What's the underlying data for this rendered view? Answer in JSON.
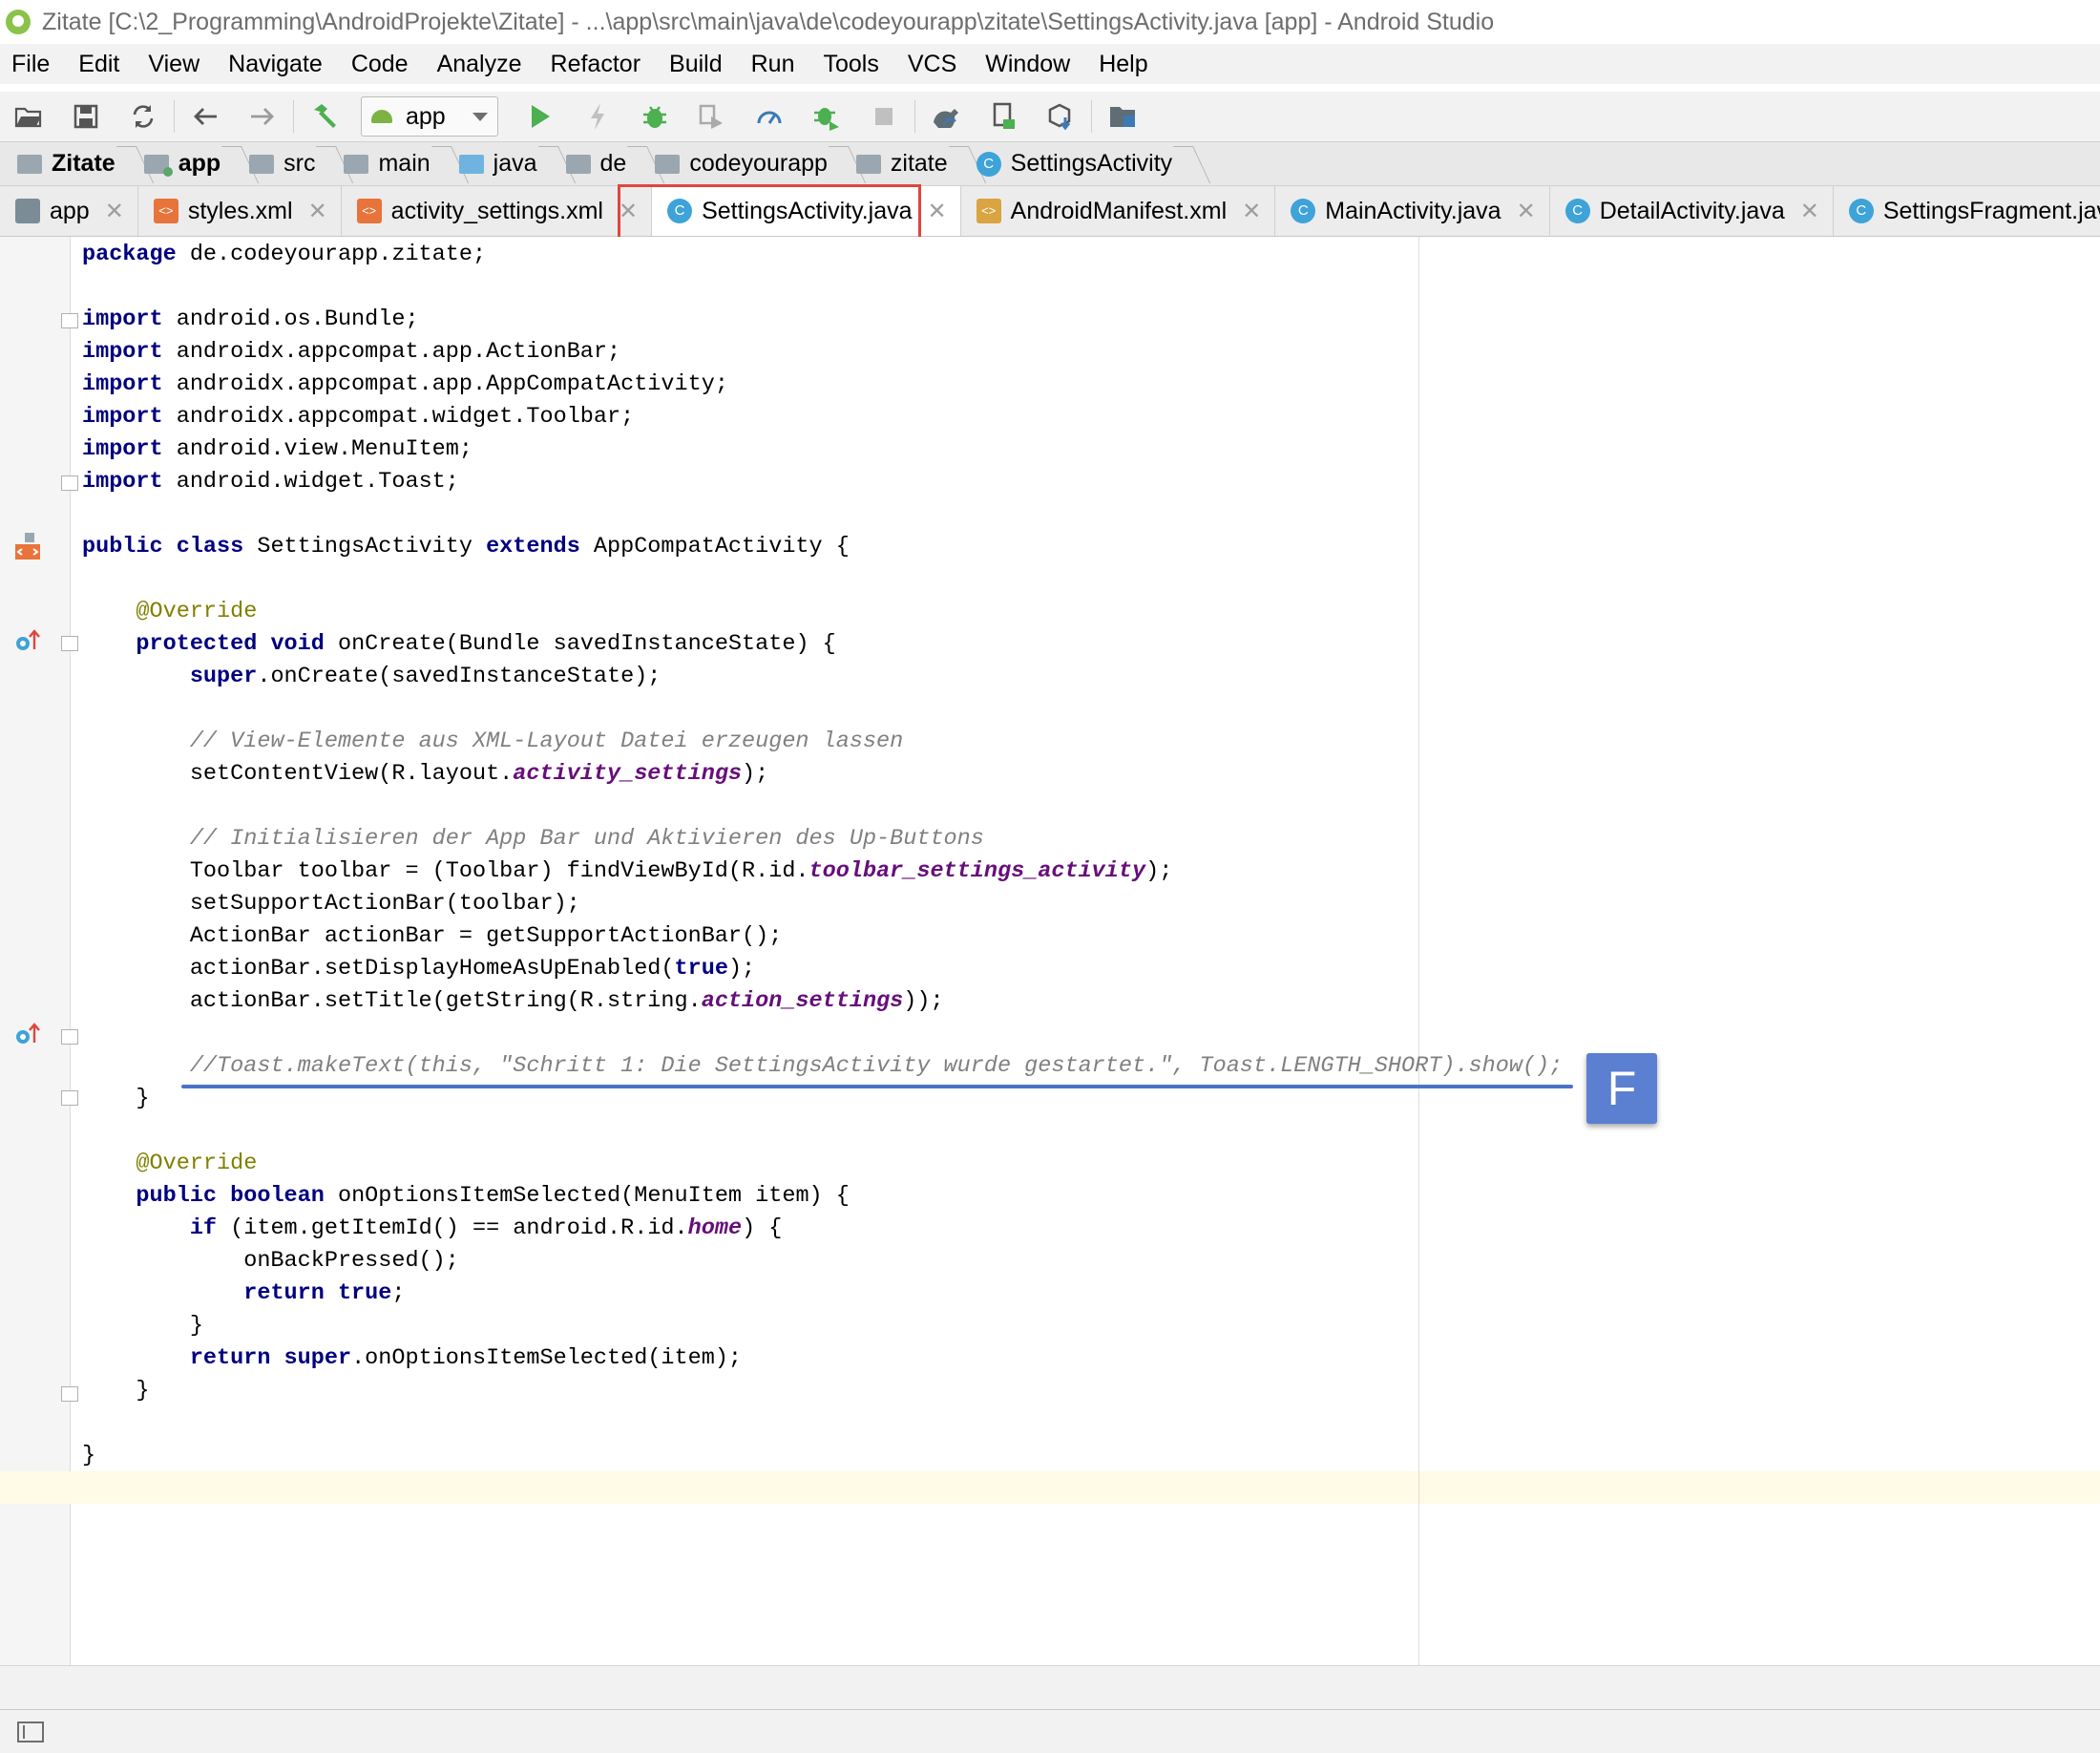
{
  "window": {
    "title": "Zitate [C:\\2_Programming\\AndroidProjekte\\Zitate] - ...\\app\\src\\main\\java\\de\\codeyourapp\\zitate\\SettingsActivity.java [app] - Android Studio"
  },
  "menu": [
    "File",
    "Edit",
    "View",
    "Navigate",
    "Code",
    "Analyze",
    "Refactor",
    "Build",
    "Run",
    "Tools",
    "VCS",
    "Window",
    "Help"
  ],
  "toolbar": {
    "run_config": "app",
    "icons": [
      "open-icon",
      "save-icon",
      "sync-icon",
      "back-icon",
      "forward-icon",
      "make-project-icon",
      "run-icon",
      "apply-changes-icon",
      "debug-icon",
      "profile-icon",
      "attach-debugger-icon",
      "stop-icon",
      "gradle-sync-icon",
      "avd-manager-icon",
      "sdk-manager-icon",
      "project-structure-icon"
    ]
  },
  "breadcrumb": [
    "Zitate",
    "app",
    "src",
    "main",
    "java",
    "de",
    "codeyourapp",
    "zitate",
    "SettingsActivity"
  ],
  "tabs": [
    {
      "label": "app",
      "active": false,
      "icon": "gradle"
    },
    {
      "label": "styles.xml",
      "active": false,
      "icon": "xml"
    },
    {
      "label": "activity_settings.xml",
      "active": false,
      "icon": "xml"
    },
    {
      "label": "SettingsActivity.java",
      "active": true,
      "icon": "class"
    },
    {
      "label": "AndroidManifest.xml",
      "active": false,
      "icon": "manifest"
    },
    {
      "label": "MainActivity.java",
      "active": false,
      "icon": "class"
    },
    {
      "label": "DetailActivity.java",
      "active": false,
      "icon": "class"
    },
    {
      "label": "SettingsFragment.java",
      "active": false,
      "icon": "class"
    }
  ],
  "editor": {
    "lines": [
      [
        [
          "kw",
          "package"
        ],
        [
          "t",
          " de.codeyourapp.zitate;"
        ]
      ],
      [],
      [
        [
          "kw",
          "import"
        ],
        [
          "t",
          " android.os.Bundle;"
        ]
      ],
      [
        [
          "kw",
          "import"
        ],
        [
          "t",
          " androidx.appcompat.app.ActionBar;"
        ]
      ],
      [
        [
          "kw",
          "import"
        ],
        [
          "t",
          " androidx.appcompat.app.AppCompatActivity;"
        ]
      ],
      [
        [
          "kw",
          "import"
        ],
        [
          "t",
          " androidx.appcompat.widget.Toolbar;"
        ]
      ],
      [
        [
          "kw",
          "import"
        ],
        [
          "t",
          " android.view.MenuItem;"
        ]
      ],
      [
        [
          "kw",
          "import"
        ],
        [
          "t",
          " android.widget.Toast;"
        ]
      ],
      [],
      [
        [
          "kw",
          "public class"
        ],
        [
          "t",
          " SettingsActivity "
        ],
        [
          "kw",
          "extends"
        ],
        [
          "t",
          " AppCompatActivity {"
        ]
      ],
      [],
      [
        [
          "t",
          "    "
        ],
        [
          "an",
          "@Override"
        ]
      ],
      [
        [
          "t",
          "    "
        ],
        [
          "kw",
          "protected void"
        ],
        [
          "t",
          " onCreate(Bundle savedInstanceState) {"
        ]
      ],
      [
        [
          "t",
          "        "
        ],
        [
          "kw",
          "super"
        ],
        [
          "t",
          ".onCreate(savedInstanceState);"
        ]
      ],
      [],
      [
        [
          "t",
          "        "
        ],
        [
          "cm",
          "// View-Elemente aus XML-Layout Datei erzeugen lassen"
        ]
      ],
      [
        [
          "t",
          "        setContentView(R.layout."
        ],
        [
          "fd",
          "activity_settings"
        ],
        [
          "t",
          ");"
        ]
      ],
      [],
      [
        [
          "t",
          "        "
        ],
        [
          "cm",
          "// Initialisieren der App Bar und Aktivieren des Up-Buttons"
        ]
      ],
      [
        [
          "t",
          "        Toolbar toolbar = (Toolbar) findViewById(R.id."
        ],
        [
          "fd",
          "toolbar_settings_activity"
        ],
        [
          "t",
          ");"
        ]
      ],
      [
        [
          "t",
          "        setSupportActionBar(toolbar);"
        ]
      ],
      [
        [
          "t",
          "        ActionBar actionBar = getSupportActionBar();"
        ]
      ],
      [
        [
          "t",
          "        actionBar.setDisplayHomeAsUpEnabled("
        ],
        [
          "kw",
          "true"
        ],
        [
          "t",
          ");"
        ]
      ],
      [
        [
          "t",
          "        actionBar.setTitle(getString(R.string."
        ],
        [
          "fd",
          "action_settings"
        ],
        [
          "t",
          "));"
        ]
      ],
      [],
      [
        [
          "t",
          "        "
        ],
        [
          "cm",
          "//Toast.makeText(this, \"Schritt 1: Die SettingsActivity wurde gestartet.\", Toast.LENGTH_SHORT).show();"
        ]
      ],
      [
        [
          "t",
          "    }"
        ]
      ],
      [],
      [
        [
          "t",
          "    "
        ],
        [
          "an",
          "@Override"
        ]
      ],
      [
        [
          "t",
          "    "
        ],
        [
          "kw",
          "public boolean"
        ],
        [
          "t",
          " onOptionsItemSelected(MenuItem item) {"
        ]
      ],
      [
        [
          "t",
          "        "
        ],
        [
          "kw",
          "if"
        ],
        [
          "t",
          " (item.getItemId() == android.R.id."
        ],
        [
          "fd",
          "home"
        ],
        [
          "t",
          ") {"
        ]
      ],
      [
        [
          "t",
          "            onBackPressed();"
        ]
      ],
      [
        [
          "t",
          "            "
        ],
        [
          "kw",
          "return true"
        ],
        [
          "t",
          ";"
        ]
      ],
      [
        [
          "t",
          "        }"
        ]
      ],
      [
        [
          "t",
          "        "
        ],
        [
          "kw",
          "return super"
        ],
        [
          "t",
          ".onOptionsItemSelected(item);"
        ]
      ],
      [
        [
          "t",
          "    }"
        ]
      ],
      [],
      [
        [
          "t",
          "}"
        ]
      ]
    ]
  },
  "annotation": {
    "badge": "F"
  }
}
